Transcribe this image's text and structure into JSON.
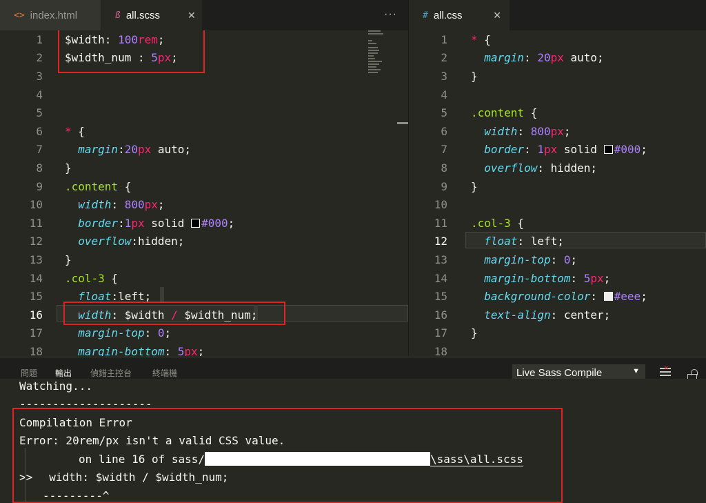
{
  "tabs_left": [
    {
      "label": "index.html",
      "icon": "code-brackets-icon",
      "glyph": "<>",
      "active": false
    },
    {
      "label": "all.scss",
      "icon": "sass-icon",
      "glyph": "ß",
      "active": true
    }
  ],
  "more_glyph": "···",
  "tab_right": {
    "label": "all.css",
    "icon": "hash-icon",
    "glyph": "#",
    "close": "✕"
  },
  "scss_lines": [
    "1",
    "2",
    "3",
    "4",
    "5",
    "6",
    "7",
    "8",
    "9",
    "10",
    "11",
    "12",
    "13",
    "14",
    "15",
    "16",
    "17",
    "18"
  ],
  "css_lines": [
    "1",
    "2",
    "3",
    "4",
    "5",
    "6",
    "7",
    "8",
    "9",
    "10",
    "11",
    "12",
    "13",
    "14",
    "15",
    "16",
    "17",
    "18"
  ],
  "scss": {
    "var_width": "$width",
    "val_width_num": "100",
    "val_width_unit": "rem",
    "var_width_num": "$width_num",
    "val_num_num": "5",
    "val_num_unit": "px",
    "star": "*",
    "margin": "margin",
    "margin_val": "20",
    "margin_unit": "px",
    "auto": "auto",
    "content_sel": ".content",
    "width": "width",
    "width_val": "800",
    "border": "border",
    "border_val": "1",
    "solid": "solid",
    "color_000": "#000",
    "overflow": "overflow",
    "hidden": "hidden",
    "col_sel": ".col-3",
    "float": "float",
    "left": "left",
    "width_expr_a": "$width",
    "slash": "/",
    "width_expr_b": "$width_num",
    "margin_top": "margin-top",
    "zero": "0",
    "margin_bottom": "margin-bottom",
    "mb_val": "5"
  },
  "css": {
    "star": "*",
    "margin": "margin",
    "margin_val": "20",
    "px": "px",
    "auto": "auto",
    "content_sel": ".content",
    "width": "width",
    "width_val": "800",
    "border": "border",
    "border_val": "1",
    "solid": "solid",
    "color_000": "#000",
    "overflow": "overflow",
    "hidden": "hidden",
    "col_sel": ".col-3",
    "float": "float",
    "left": "left",
    "margin_top": "margin-top",
    "zero": "0",
    "margin_bottom": "margin-bottom",
    "mb_val": "5",
    "bg": "background-color",
    "color_eee": "#eee",
    "text_align": "text-align",
    "center": "center"
  },
  "colors": {
    "swatch_black": "#000000",
    "swatch_eee": "#eeeeee",
    "error_box": "#e02424"
  },
  "panel": {
    "tabs": [
      "問題",
      "輸出",
      "偵錯主控台",
      "終端機"
    ],
    "active_tab": "輸出",
    "select_value": "Live Sass Compile",
    "select_arrow": "▼"
  },
  "output": {
    "watching": "Watching...",
    "rule": "--------------------",
    "error_title": "Compilation Error",
    "error_msg": "Error: 20rem/px isn't a valid CSS value.",
    "on_line_prefix": "on line 16 of sass/",
    "on_line_suffix": "\\sass\\all.scss",
    "source_prefix": ">>",
    "source_line": "width: $width / $width_num;",
    "caret": "---------^"
  }
}
